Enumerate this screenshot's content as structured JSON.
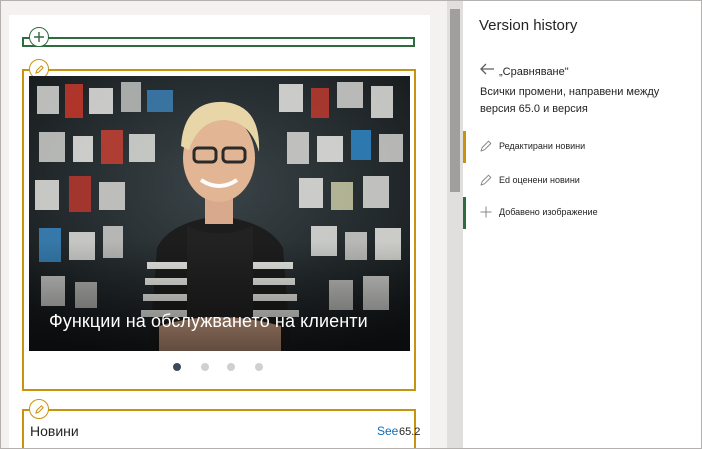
{
  "hero": {
    "title": "Функции на обслужването на клиенти",
    "carousel_dots": 4,
    "active_dot": 0
  },
  "news": {
    "title": "Новини",
    "see_label": "See",
    "version_tag": "65.2"
  },
  "version_panel": {
    "title": "Version history",
    "back_label": "„Сравняване\"",
    "compare_description": "Всички промени, направени между версия 65.0 и версия",
    "changes": [
      {
        "label": "Редактирани новини",
        "icon": "pencil-icon",
        "bar_color": "#c8940f"
      },
      {
        "label": "Ed оценени новини",
        "icon": "pencil-icon",
        "bar_color": "#c8940f"
      },
      {
        "label": "Добавено изображение",
        "icon": "plus-icon",
        "bar_color": "#2e6b3e"
      }
    ]
  },
  "colors": {
    "edited_accent": "#c8940f",
    "added_accent": "#2e6b3e",
    "link": "#0f6cbd"
  }
}
